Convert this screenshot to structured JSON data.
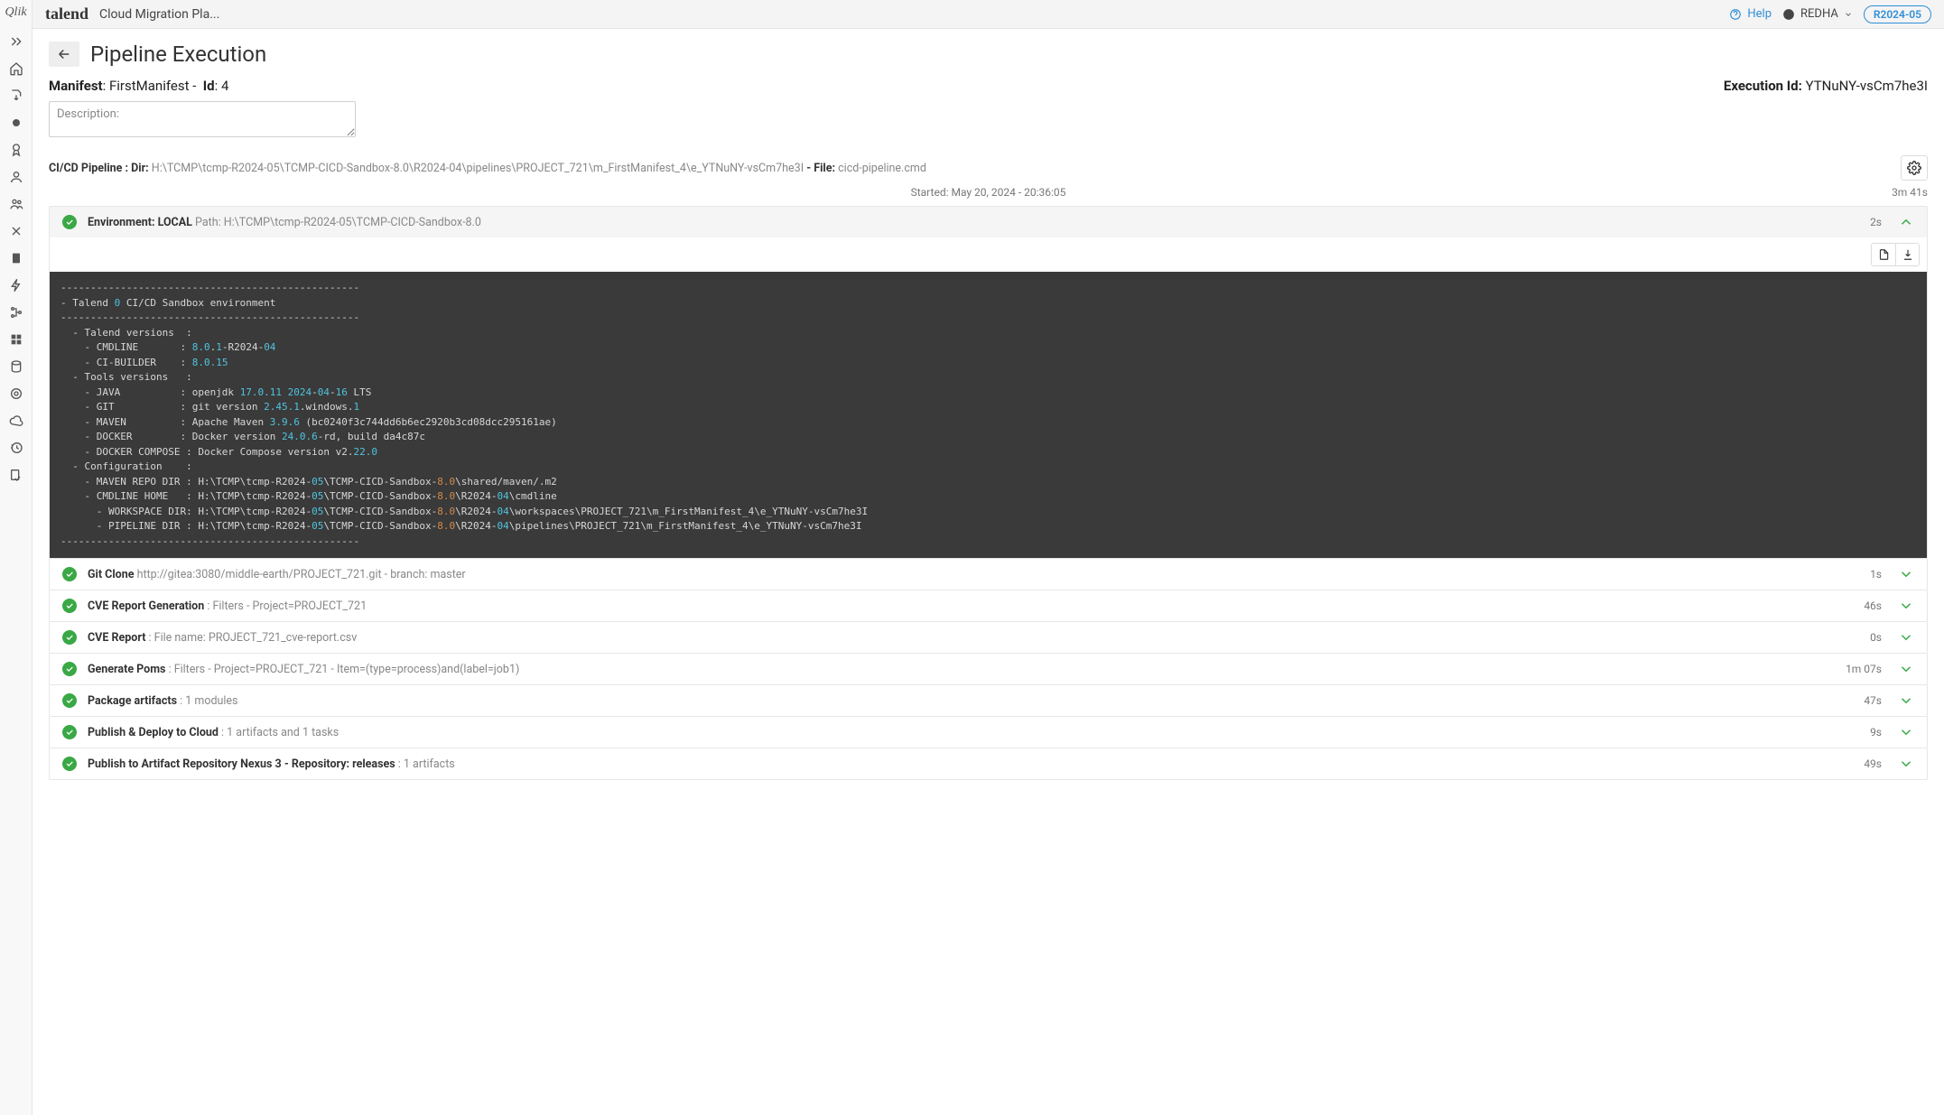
{
  "topbar": {
    "qlik": "Qlik",
    "brand": "talend",
    "app_title": "Cloud Migration Pla...",
    "help": "Help",
    "user": "REDHA",
    "version": "R2024-05"
  },
  "sidebar": {
    "items": [
      {
        "name": "expand-icon"
      },
      {
        "name": "home-icon"
      },
      {
        "name": "export-icon"
      },
      {
        "name": "status-icon"
      },
      {
        "name": "badge-icon"
      },
      {
        "name": "user-icon"
      },
      {
        "name": "users-icon"
      },
      {
        "name": "tools-icon"
      },
      {
        "name": "info-icon"
      },
      {
        "name": "flash-icon"
      },
      {
        "name": "tree-icon"
      },
      {
        "name": "grid-icon"
      },
      {
        "name": "db-icon"
      },
      {
        "name": "target-icon"
      },
      {
        "name": "cloud-icon"
      },
      {
        "name": "history-icon"
      },
      {
        "name": "checkout-icon"
      }
    ]
  },
  "page": {
    "title": "Pipeline Execution",
    "manifest_label": "Manifest",
    "manifest_value": "FirstManifest",
    "id_label": "Id",
    "id_value": "4",
    "exec_label": "Execution Id:",
    "exec_value": "YTNuNY-vsCm7he3I",
    "desc_label": "Description:",
    "dir_label": "CI/CD Pipeline : Dir:",
    "dir_path": "H:\\TCMP\\tcmp-R2024-05\\TCMP-CICD-Sandbox-8.0\\R2024-04\\pipelines\\PROJECT_721\\m_FirstManifest_4\\e_YTNuNY-vsCm7he3I",
    "file_label": "- File:",
    "file_value": "cicd-pipeline.cmd",
    "started": "Started: May 20, 2024 - 20:36:05",
    "total_duration": "3m 41s"
  },
  "steps": [
    {
      "title": "Environment: LOCAL",
      "sub_label": "Path:",
      "sub": "H:\\TCMP\\tcmp-R2024-05\\TCMP-CICD-Sandbox-8.0",
      "dur": "2s",
      "expanded": true,
      "head": true
    },
    {
      "title": "Git Clone",
      "sub": "http://gitea:3080/middle-earth/PROJECT_721.git - branch: master",
      "dur": "1s"
    },
    {
      "title": "CVE Report Generation",
      "sub": ": Filters - Project=PROJECT_721",
      "dur": "46s"
    },
    {
      "title": "CVE Report",
      "sub": ": File name: PROJECT_721_cve-report.csv",
      "dur": "0s"
    },
    {
      "title": "Generate Poms",
      "sub": ": Filters - Project=PROJECT_721 - Item=(type=process)and(label=job1)",
      "dur": "1m 07s"
    },
    {
      "title": "Package artifacts",
      "sub": ": 1 modules",
      "dur": "47s"
    },
    {
      "title": "Publish & Deploy to Cloud",
      "sub": ": 1 artifacts and 1 tasks",
      "dur": "9s"
    },
    {
      "title": "Publish to Artifact Repository Nexus 3 - Repository: releases",
      "sub": ": 1 artifacts",
      "dur": "49s"
    }
  ],
  "console": {
    "raw": "--------------------------------------------------\n- Talend <n>0</n> CI/CD Sandbox environment\n--------------------------------------------------\n  - Talend versions  :\n    - CMDLINE       : <n>8.0</n>.<n>1</n>-R2024-<n>04</n>\n    - CI-BUILDER    : <n>8.0.15</n>\n  - Tools versions   :\n    - JAVA          : openjdk <n>17.0.11</n> <n>2024</n>-<n>04</n>-<n>16</n> LTS\n    - GIT           : git version <n>2.45.1</n>.windows.<n>1</n>\n    - MAVEN         : Apache Maven <n>3.9.6</n> (bc0240f3c744dd6b6ec2920b3cd08dcc295161ae)\n    - DOCKER        : Docker version <n>24.0.6</n>-rd, build da4c87c\n    - DOCKER COMPOSE : Docker Compose version v2.<n>22.0</n>\n  - Configuration    :\n    - MAVEN REPO DIR : H:\\TCMP\\tcmp-R2024-<n>05</n>\\TCMP-CICD-Sandbox-<h>8.0</h>\\shared/maven/.m2\n    - CMDLINE HOME   : H:\\TCMP\\tcmp-R2024-<n>05</n>\\TCMP-CICD-Sandbox-<h>8.0</h>\\R2024-<n>04</n>\\cmdline\n      - WORKSPACE DIR: H:\\TCMP\\tcmp-R2024-<n>05</n>\\TCMP-CICD-Sandbox-<h>8.0</h>\\R2024-<n>04</n>\\workspaces\\PROJECT_721\\m_FirstManifest_4\\e_YTNuNY-vsCm7he3I\n      - PIPELINE DIR : H:\\TCMP\\tcmp-R2024-<n>05</n>\\TCMP-CICD-Sandbox-<h>8.0</h>\\R2024-<n>04</n>\\pipelines\\PROJECT_721\\m_FirstManifest_4\\e_YTNuNY-vsCm7he3I\n--------------------------------------------------"
  }
}
